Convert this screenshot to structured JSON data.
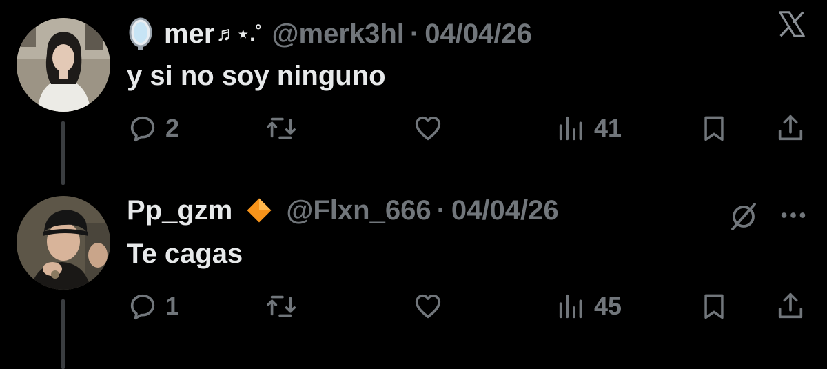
{
  "tweets": [
    {
      "display_name": "mer",
      "name_decoration": "♬⋆.˚",
      "name_emoji_icon": "mirror-icon",
      "handle": "@merk3hl",
      "separator": "·",
      "date": "04/04/26",
      "text": "y si no soy ninguno",
      "reply_count": "2",
      "retweet_count": "",
      "like_count": "",
      "view_count": "41",
      "corner_icon": "x-logo-icon"
    },
    {
      "display_name": "Pp_gzm",
      "badge_icon": "orange-diamond-icon",
      "handle": "@Flxn_666",
      "separator": "·",
      "date": "04/04/26",
      "text": "Te cagas",
      "reply_count": "1",
      "retweet_count": "",
      "like_count": "",
      "view_count": "45",
      "corner_icons": [
        "grok-icon",
        "more-icon"
      ]
    }
  ],
  "colors": {
    "background": "#000000",
    "primary_text": "#e7e9ea",
    "secondary_text": "#71767b",
    "thread_line": "#3a3d40",
    "badge_orange": "#f7931a"
  }
}
